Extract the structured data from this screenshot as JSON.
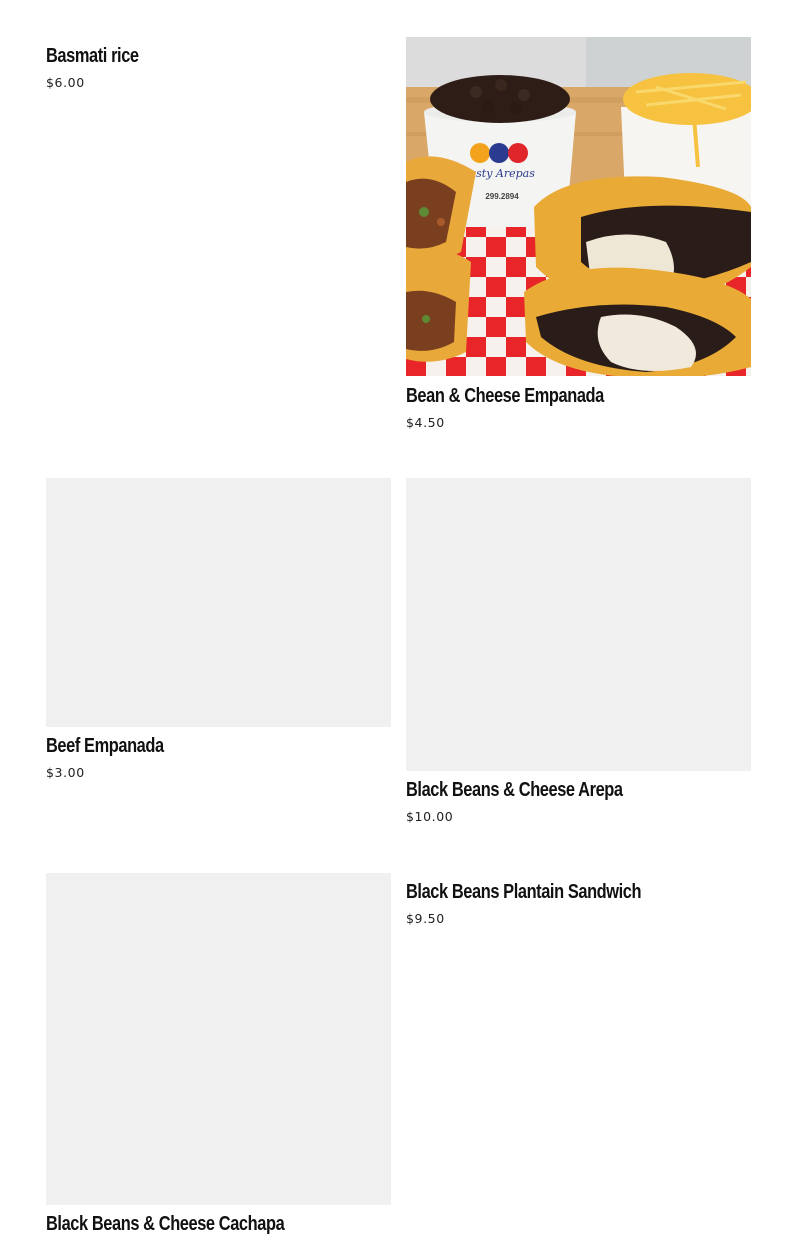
{
  "products": [
    {
      "name": "Basmati rice",
      "price": "$6.00"
    },
    {
      "name": "Bean & Cheese Empanada",
      "price": "$4.50"
    },
    {
      "name": "Beef Empanada",
      "price": "$3.00"
    },
    {
      "name": "Black Beans & Cheese Arepa",
      "price": "$10.00"
    },
    {
      "name": "Black Beans & Cheese Cachapa"
    },
    {
      "name": "Black Beans Plantain Sandwich",
      "price": "$9.50"
    }
  ],
  "photo": {
    "brand_text": "Tasty Arepas",
    "phone_text": "299.2894"
  },
  "colors": {
    "placeholder": "#f0f0f0",
    "text": "#111111",
    "checker_red": "#e8262a"
  }
}
